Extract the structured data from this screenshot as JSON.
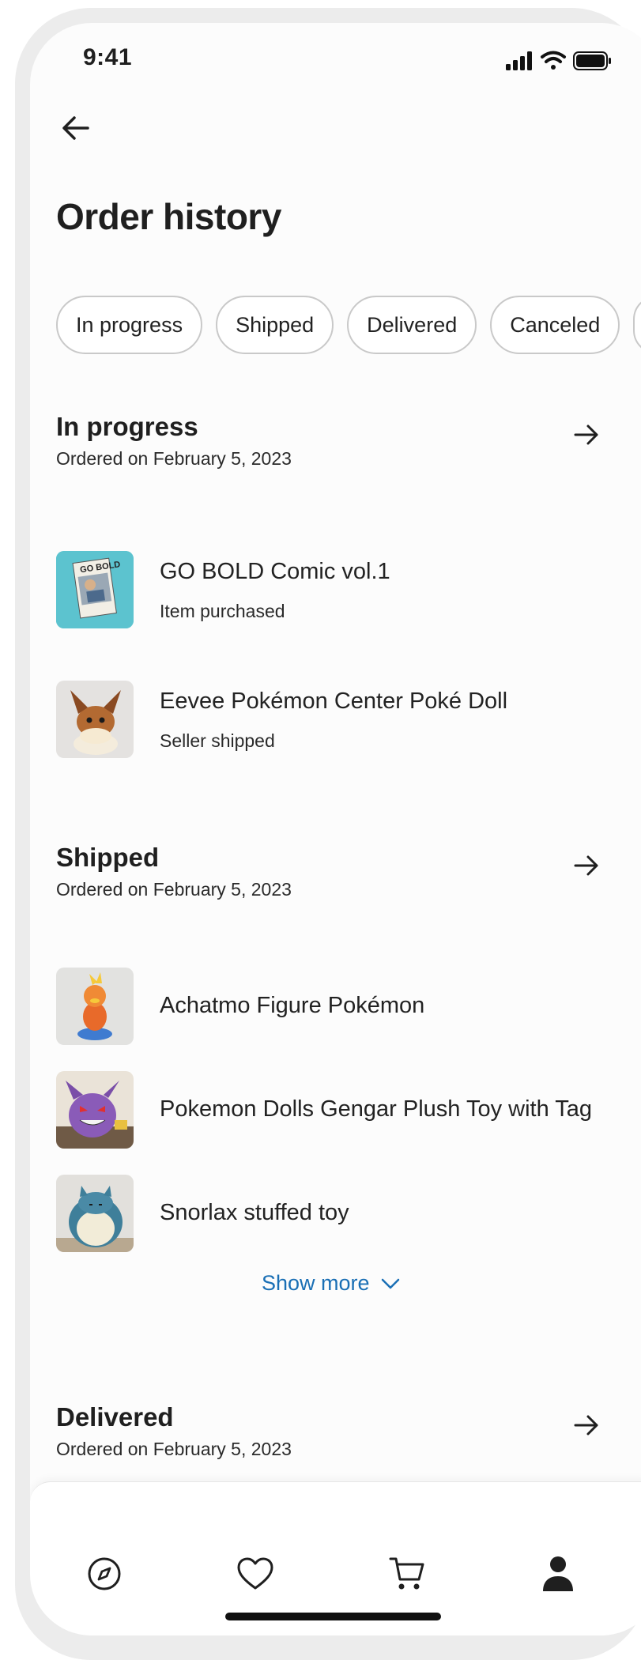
{
  "status_bar": {
    "time": "9:41",
    "icons": [
      "signal-icon",
      "wifi-icon",
      "battery-icon"
    ]
  },
  "header": {
    "back_icon": "arrow-left-icon",
    "title": "Order history"
  },
  "filters": [
    {
      "label": "In progress"
    },
    {
      "label": "Shipped"
    },
    {
      "label": "Delivered"
    },
    {
      "label": "Canceled"
    }
  ],
  "sections": {
    "in_progress": {
      "title": "In progress",
      "date": "Ordered on February 5, 2023",
      "items": [
        {
          "name": "GO BOLD Comic vol.1",
          "status": "Item purchased",
          "thumb_text": "GO BOLD"
        },
        {
          "name": "Eevee Pokémon Center Poké Doll",
          "status": "Seller shipped"
        }
      ]
    },
    "shipped": {
      "title": "Shipped",
      "date": "Ordered on February 5, 2023",
      "items": [
        {
          "name": "Achatmo Figure Pokémon"
        },
        {
          "name": "Pokemon Dolls Gengar Plush Toy with Tag"
        },
        {
          "name": "Snorlax stuffed toy"
        }
      ],
      "show_more": "Show more"
    },
    "delivered": {
      "title": "Delivered",
      "date": "Ordered on February 5, 2023"
    }
  },
  "tab_bar": {
    "tabs": [
      "compass-icon",
      "heart-icon",
      "cart-icon",
      "profile-icon"
    ]
  },
  "colors": {
    "accent": "#1a6fb5",
    "text": "#1f1f1f",
    "chip_border": "#c9c9c9",
    "background": "#fcfcfc"
  }
}
